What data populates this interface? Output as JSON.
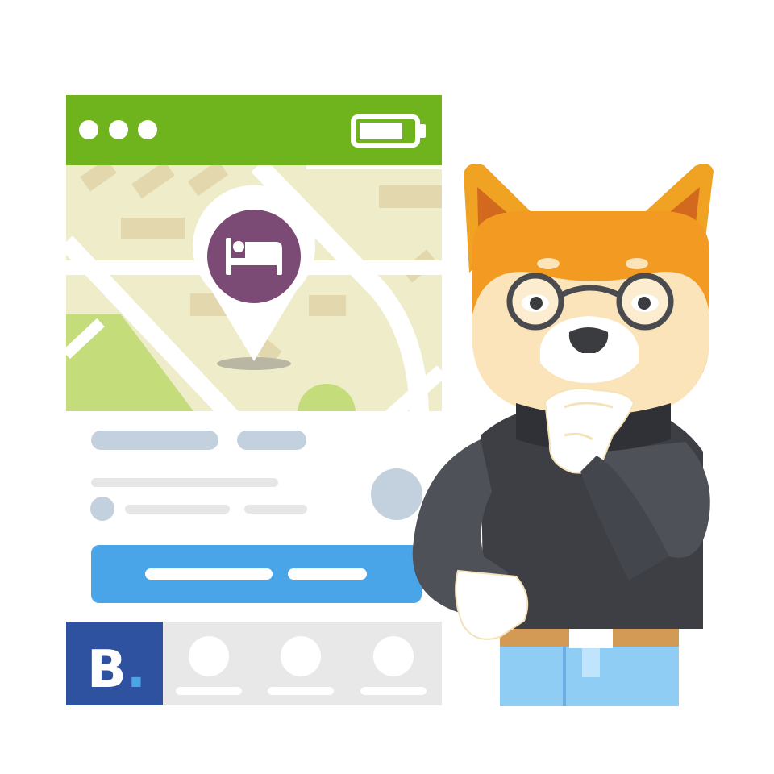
{
  "illustration": {
    "phone_header": {
      "dots": [
        "dot-1",
        "dot-2",
        "dot-3"
      ],
      "battery_level": 0.8,
      "color": "#6fb31d"
    },
    "map": {
      "pin_icon": "bed-icon",
      "pin_color": "#7b4a75",
      "land_color": "#efecca",
      "park_color": "#c5dc7b"
    },
    "cta_button": {
      "color": "#4aa5e8"
    },
    "brand_logo": {
      "text": "B.",
      "bg_color": "#2f52a0",
      "dot_color": "#4aa5e8"
    },
    "bottom_nav": {
      "items": [
        "nav-item-1",
        "nav-item-2",
        "nav-item-3"
      ]
    },
    "character": {
      "name": "shiba-dog",
      "fur_color": "#f29a22",
      "sweater_color": "#43464d",
      "jeans_color": "#8fcdf5"
    }
  }
}
